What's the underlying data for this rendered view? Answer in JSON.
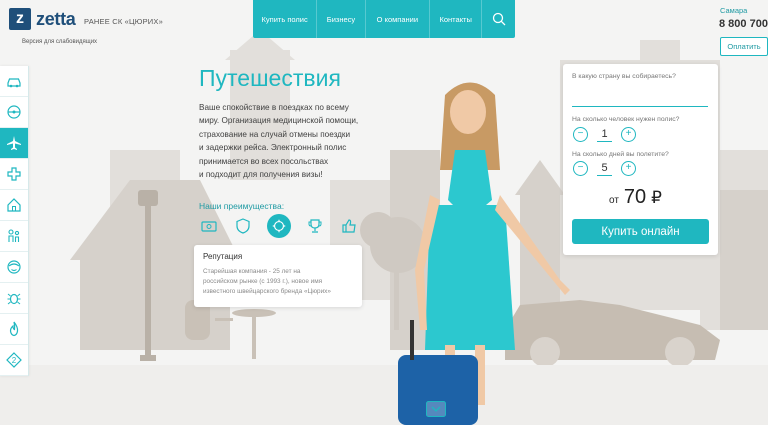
{
  "brand": {
    "logo_letter": "z",
    "name": "zetta",
    "tagline": "РАНЕЕ СК «ЦЮРИХ»",
    "accessibility_link": "Версия для слабовидящих",
    "accent_color": "#1fb7c0"
  },
  "topnav": {
    "items": [
      "Купить полис",
      "Бизнесу",
      "О компании",
      "Контакты"
    ],
    "search_icon": "search-icon"
  },
  "header_right": {
    "city": "Самара",
    "phone": "8 800 700",
    "pay_label": "Оплатить"
  },
  "sidebar": {
    "items": [
      {
        "icon": "car-icon"
      },
      {
        "icon": "steering-wheel-icon"
      },
      {
        "icon": "airplane-icon",
        "active": true
      },
      {
        "icon": "medical-cross-icon"
      },
      {
        "icon": "house-icon"
      },
      {
        "icon": "family-icon"
      },
      {
        "icon": "face-icon"
      },
      {
        "icon": "bug-icon"
      },
      {
        "icon": "fire-icon"
      },
      {
        "icon": "number-two-icon",
        "label": "2"
      }
    ]
  },
  "hero": {
    "title": "Путешествия",
    "description_lines": [
      "Ваше спокойствие в поездках по всему",
      "миру. Организация медицинской помощи,",
      "страхование на случай отмены поездки",
      "и задержки рейса. Электронный полис",
      "принимается во всех посольствах",
      "и подходит для получения визы!"
    ],
    "advantages_title": "Наши преимущества:",
    "advantage_icons": [
      "money-icon",
      "shield-icon",
      "reputation-icon",
      "trophy-icon",
      "thumbs-up-icon"
    ],
    "advantage_card": {
      "title": "Репутация",
      "text_lines": [
        "Старейшая компания - 25 лет на",
        "российском рынке (с 1993 г.), новое имя",
        "известного швейцарского бренда «Цюрих»"
      ]
    }
  },
  "form": {
    "country_label": "В какую страну вы собираетесь?",
    "country_value": "",
    "people_label": "На сколько человек нужен полис?",
    "people_value": "1",
    "days_label": "На сколько дней вы полетите?",
    "days_value": "5",
    "minus": "−",
    "plus": "+",
    "price_prefix": "от",
    "price_value": "70",
    "price_currency": "₽",
    "buy_label": "Купить онлайн"
  }
}
